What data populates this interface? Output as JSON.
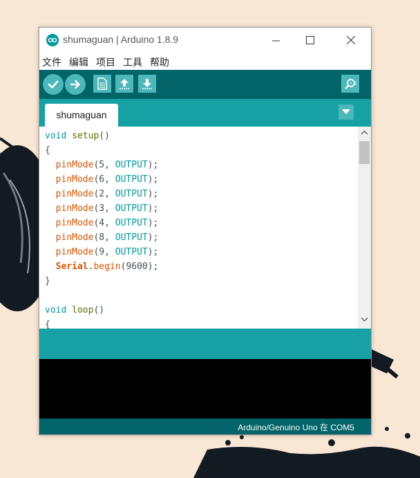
{
  "window": {
    "title": "shumaguan | Arduino 1.8.9",
    "controls": [
      "minimize",
      "maximize",
      "close"
    ]
  },
  "menu": {
    "items": [
      "文件",
      "编辑",
      "项目",
      "工具",
      "帮助"
    ]
  },
  "toolbar": {
    "buttons": [
      "verify-icon",
      "upload-icon",
      "new-icon",
      "open-icon",
      "save-icon",
      "serial-monitor-icon"
    ]
  },
  "tabs": {
    "items": [
      {
        "label": "shumaguan"
      }
    ]
  },
  "editor": {
    "lines": [
      [
        {
          "t": "kw",
          "v": "void"
        },
        {
          "t": "p",
          "v": " "
        },
        {
          "t": "nm",
          "v": "setup"
        },
        {
          "t": "p",
          "v": "()"
        }
      ],
      [
        {
          "t": "p",
          "v": "{"
        }
      ],
      [
        {
          "t": "p",
          "v": "  "
        },
        {
          "t": "fn",
          "v": "pinMode"
        },
        {
          "t": "p",
          "v": "(5, "
        },
        {
          "t": "kw",
          "v": "OUTPUT"
        },
        {
          "t": "p",
          "v": ");"
        }
      ],
      [
        {
          "t": "p",
          "v": "  "
        },
        {
          "t": "fn",
          "v": "pinMode"
        },
        {
          "t": "p",
          "v": "(6, "
        },
        {
          "t": "kw",
          "v": "OUTPUT"
        },
        {
          "t": "p",
          "v": ");"
        }
      ],
      [
        {
          "t": "p",
          "v": "  "
        },
        {
          "t": "fn",
          "v": "pinMode"
        },
        {
          "t": "p",
          "v": "(2, "
        },
        {
          "t": "kw",
          "v": "OUTPUT"
        },
        {
          "t": "p",
          "v": ");"
        }
      ],
      [
        {
          "t": "p",
          "v": "  "
        },
        {
          "t": "fn",
          "v": "pinMode"
        },
        {
          "t": "p",
          "v": "(3, "
        },
        {
          "t": "kw",
          "v": "OUTPUT"
        },
        {
          "t": "p",
          "v": ");"
        }
      ],
      [
        {
          "t": "p",
          "v": "  "
        },
        {
          "t": "fn",
          "v": "pinMode"
        },
        {
          "t": "p",
          "v": "(4, "
        },
        {
          "t": "kw",
          "v": "OUTPUT"
        },
        {
          "t": "p",
          "v": ");"
        }
      ],
      [
        {
          "t": "p",
          "v": "  "
        },
        {
          "t": "fn",
          "v": "pinMode"
        },
        {
          "t": "p",
          "v": "(8, "
        },
        {
          "t": "kw",
          "v": "OUTPUT"
        },
        {
          "t": "p",
          "v": ");"
        }
      ],
      [
        {
          "t": "p",
          "v": "  "
        },
        {
          "t": "fn",
          "v": "pinMode"
        },
        {
          "t": "p",
          "v": "(9, "
        },
        {
          "t": "kw",
          "v": "OUTPUT"
        },
        {
          "t": "p",
          "v": ");"
        }
      ],
      [
        {
          "t": "p",
          "v": "  "
        },
        {
          "t": "ob",
          "v": "Serial"
        },
        {
          "t": "p",
          "v": "."
        },
        {
          "t": "fn",
          "v": "begin"
        },
        {
          "t": "p",
          "v": "(9600);"
        }
      ],
      [
        {
          "t": "p",
          "v": "}"
        }
      ],
      [
        {
          "t": "p",
          "v": ""
        }
      ],
      [
        {
          "t": "kw",
          "v": "void"
        },
        {
          "t": "p",
          "v": " "
        },
        {
          "t": "nm",
          "v": "loop"
        },
        {
          "t": "p",
          "v": "()"
        }
      ],
      [
        {
          "t": "p",
          "v": "{"
        }
      ]
    ]
  },
  "footer": {
    "board_port": "Arduino/Genuino Uno 在 COM5"
  },
  "colors": {
    "teal_dark": "#006468",
    "teal_mid": "#17a1a5",
    "button": "#4db7bb",
    "keyword": "#00979c",
    "function": "#d35400",
    "name": "#5e6d03"
  }
}
